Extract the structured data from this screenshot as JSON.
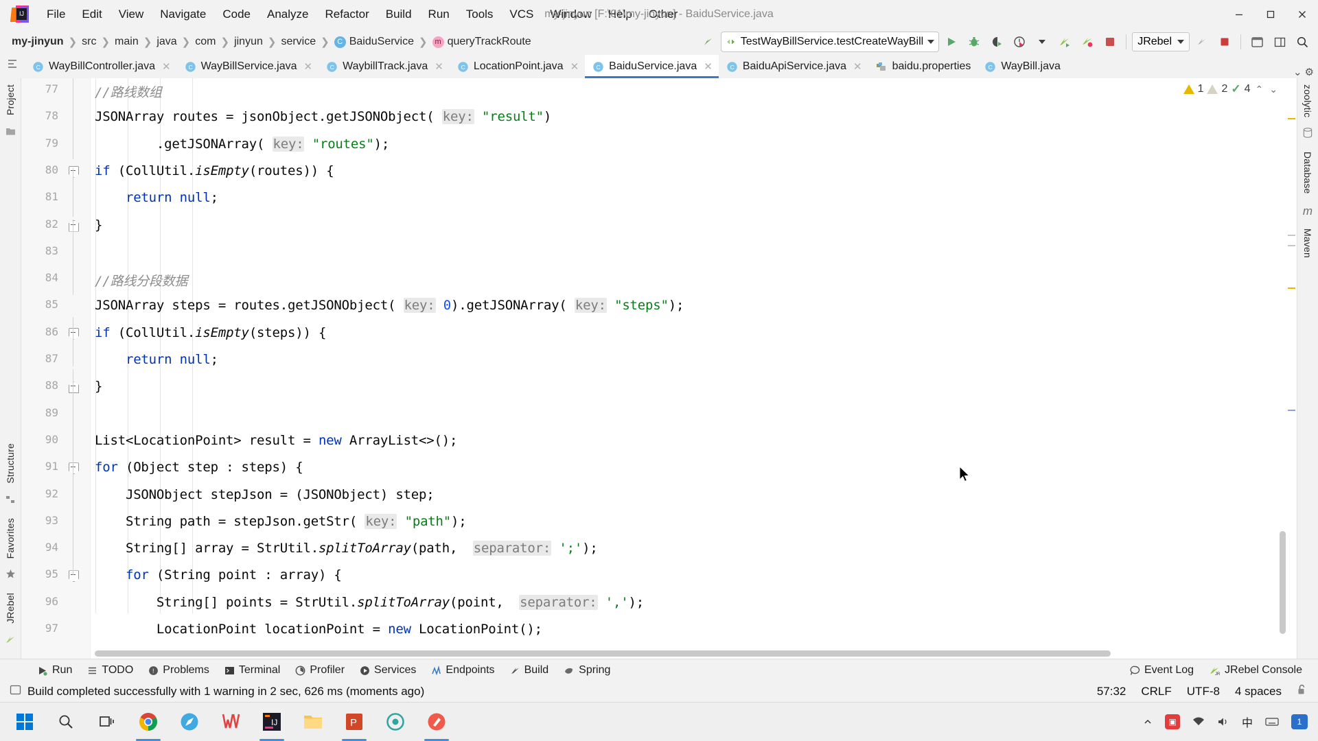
{
  "window": {
    "title": "my-jinyun [F:\\01\\my-jinyun] - BaiduService.java",
    "minimize": "—",
    "maximize": "▢",
    "close": "✕",
    "logo_text": "IJ"
  },
  "menubar": [
    {
      "label": "File",
      "mn": "F"
    },
    {
      "label": "Edit",
      "mn": "E"
    },
    {
      "label": "View",
      "mn": "V"
    },
    {
      "label": "Navigate",
      "mn": "N"
    },
    {
      "label": "Code",
      "mn": "C"
    },
    {
      "label": "Analyze",
      "mn": "z"
    },
    {
      "label": "Refactor",
      "mn": "R"
    },
    {
      "label": "Build",
      "mn": "B"
    },
    {
      "label": "Run",
      "mn": "u"
    },
    {
      "label": "Tools",
      "mn": "T"
    },
    {
      "label": "VCS",
      "mn": ""
    },
    {
      "label": "Window",
      "mn": "W"
    },
    {
      "label": "Help",
      "mn": "H"
    },
    {
      "label": "Other",
      "mn": ""
    }
  ],
  "breadcrumbs": [
    {
      "label": "my-jinyun",
      "icon": "",
      "bold": true
    },
    {
      "label": "src",
      "icon": ""
    },
    {
      "label": "main",
      "icon": ""
    },
    {
      "label": "java",
      "icon": ""
    },
    {
      "label": "com",
      "icon": ""
    },
    {
      "label": "jinyun",
      "icon": ""
    },
    {
      "label": "service",
      "icon": ""
    },
    {
      "label": "BaiduService",
      "icon": "class-icon",
      "icon_letter": "C"
    },
    {
      "label": "queryTrackRoute",
      "icon": "method-icon",
      "icon_letter": "m"
    }
  ],
  "toolbar": {
    "run_config": "TestWayBillService.testCreateWayBill",
    "jrebel_label": "JRebel",
    "icons": [
      "run-icon",
      "debug-icon",
      "run-with-coverage-icon",
      "profiler-icon",
      "profiler-dropdown-icon",
      "jrebel-run-icon",
      "jrebel-debug-icon",
      "stop-icon",
      "search-everywhere-icon"
    ]
  },
  "tabs": [
    {
      "label": "WayBillController.java",
      "icon": "java-class-icon",
      "active": false,
      "close": "✕"
    },
    {
      "label": "WayBillService.java",
      "icon": "java-class-icon",
      "active": false,
      "close": "✕"
    },
    {
      "label": "WaybillTrack.java",
      "icon": "java-class-icon",
      "active": false,
      "close": "✕"
    },
    {
      "label": "LocationPoint.java",
      "icon": "java-class-icon",
      "active": false,
      "close": "✕"
    },
    {
      "label": "BaiduService.java",
      "icon": "java-class-icon",
      "active": true,
      "close": "✕"
    },
    {
      "label": "BaiduApiService.java",
      "icon": "java-class-icon",
      "active": false,
      "close": "✕"
    },
    {
      "label": "baidu.properties",
      "icon": "properties-icon",
      "active": false,
      "close": ""
    },
    {
      "label": "WayBill.java",
      "icon": "java-class-icon",
      "active": false,
      "close": ""
    }
  ],
  "left_tool_windows": [
    {
      "label": "Project",
      "name": "tool-window-project"
    },
    {
      "label": "Structure",
      "name": "tool-window-structure"
    },
    {
      "label": "Favorites",
      "name": "tool-window-favorites"
    },
    {
      "label": "JRebel",
      "name": "tool-window-jrebel"
    }
  ],
  "right_tool_windows": [
    {
      "label": "zoolytic",
      "name": "tool-window-zoolytic"
    },
    {
      "label": "Database",
      "name": "tool-window-database"
    },
    {
      "label": "Maven",
      "name": "tool-window-maven"
    }
  ],
  "inspections": {
    "warnings": "1",
    "weak_warnings": "2",
    "ok_count": "4",
    "up": "⌃",
    "down": "⌄"
  },
  "editor": {
    "first_line": 77,
    "lines": [
      {
        "n": 77,
        "indent": 2,
        "tokens": [
          {
            "t": "//路线数组",
            "c": "cmt"
          }
        ]
      },
      {
        "n": 78,
        "indent": 2,
        "tokens": [
          {
            "t": "JSONArray routes = jsonObject.getJSONObject( ",
            "c": ""
          },
          {
            "t": "key:",
            "c": "hint"
          },
          {
            "t": " ",
            "c": ""
          },
          {
            "t": "\"result\"",
            "c": "str"
          },
          {
            "t": ")",
            "c": ""
          }
        ]
      },
      {
        "n": 79,
        "indent": 2,
        "tokens": [
          {
            "t": "        .getJSONArray( ",
            "c": ""
          },
          {
            "t": "key:",
            "c": "hint"
          },
          {
            "t": " ",
            "c": ""
          },
          {
            "t": "\"routes\"",
            "c": "str"
          },
          {
            "t": ");",
            "c": ""
          }
        ]
      },
      {
        "n": 80,
        "indent": 2,
        "fold": "start",
        "tokens": [
          {
            "t": "if",
            "c": "kw"
          },
          {
            "t": " (CollUtil.",
            "c": ""
          },
          {
            "t": "isEmpty",
            "c": "italmeth"
          },
          {
            "t": "(routes)) {",
            "c": ""
          }
        ]
      },
      {
        "n": 81,
        "indent": 3,
        "tokens": [
          {
            "t": "    ",
            "c": ""
          },
          {
            "t": "return",
            "c": "kw"
          },
          {
            "t": " ",
            "c": ""
          },
          {
            "t": "null",
            "c": "kw"
          },
          {
            "t": ";",
            "c": ""
          }
        ]
      },
      {
        "n": 82,
        "indent": 2,
        "fold": "end",
        "tokens": [
          {
            "t": "}",
            "c": ""
          }
        ]
      },
      {
        "n": 83,
        "indent": 2,
        "tokens": []
      },
      {
        "n": 84,
        "indent": 2,
        "tokens": [
          {
            "t": "//路线分段数据",
            "c": "cmt"
          }
        ]
      },
      {
        "n": 85,
        "indent": 2,
        "tokens": [
          {
            "t": "JSONArray steps = routes.getJSONObject( ",
            "c": ""
          },
          {
            "t": "key:",
            "c": "hint"
          },
          {
            "t": " ",
            "c": ""
          },
          {
            "t": "0",
            "c": "num"
          },
          {
            "t": ").getJSONArray( ",
            "c": ""
          },
          {
            "t": "key:",
            "c": "hint"
          },
          {
            "t": " ",
            "c": ""
          },
          {
            "t": "\"steps\"",
            "c": "str"
          },
          {
            "t": ");",
            "c": ""
          }
        ]
      },
      {
        "n": 86,
        "indent": 2,
        "fold": "start",
        "tokens": [
          {
            "t": "if",
            "c": "kw"
          },
          {
            "t": " (CollUtil.",
            "c": ""
          },
          {
            "t": "isEmpty",
            "c": "italmeth"
          },
          {
            "t": "(steps)) {",
            "c": ""
          }
        ]
      },
      {
        "n": 87,
        "indent": 3,
        "tokens": [
          {
            "t": "    ",
            "c": ""
          },
          {
            "t": "return",
            "c": "kw"
          },
          {
            "t": " ",
            "c": ""
          },
          {
            "t": "null",
            "c": "kw"
          },
          {
            "t": ";",
            "c": ""
          }
        ]
      },
      {
        "n": 88,
        "indent": 2,
        "fold": "end",
        "tokens": [
          {
            "t": "}",
            "c": ""
          }
        ]
      },
      {
        "n": 89,
        "indent": 2,
        "tokens": []
      },
      {
        "n": 90,
        "indent": 2,
        "tokens": [
          {
            "t": "List<LocationPoint> result = ",
            "c": ""
          },
          {
            "t": "new",
            "c": "kw"
          },
          {
            "t": " ArrayList<>();",
            "c": ""
          }
        ]
      },
      {
        "n": 91,
        "indent": 2,
        "fold": "start",
        "tokens": [
          {
            "t": "for",
            "c": "kw"
          },
          {
            "t": " (Object step : steps) {",
            "c": ""
          }
        ]
      },
      {
        "n": 92,
        "indent": 3,
        "tokens": [
          {
            "t": "    JSONObject stepJson = (JSONObject) step;",
            "c": ""
          }
        ]
      },
      {
        "n": 93,
        "indent": 3,
        "tokens": [
          {
            "t": "    String path = stepJson.getStr( ",
            "c": ""
          },
          {
            "t": "key:",
            "c": "hint"
          },
          {
            "t": " ",
            "c": ""
          },
          {
            "t": "\"path\"",
            "c": "str"
          },
          {
            "t": ");",
            "c": ""
          }
        ]
      },
      {
        "n": 94,
        "indent": 3,
        "tokens": [
          {
            "t": "    String[] array = StrUtil.",
            "c": ""
          },
          {
            "t": "splitToArray",
            "c": "italmeth"
          },
          {
            "t": "(path,  ",
            "c": ""
          },
          {
            "t": "separator:",
            "c": "hint"
          },
          {
            "t": " ",
            "c": ""
          },
          {
            "t": "';'",
            "c": "str"
          },
          {
            "t": ");",
            "c": ""
          }
        ]
      },
      {
        "n": 95,
        "indent": 3,
        "fold": "start",
        "tokens": [
          {
            "t": "    ",
            "c": ""
          },
          {
            "t": "for",
            "c": "kw"
          },
          {
            "t": " (String point : array) {",
            "c": ""
          }
        ]
      },
      {
        "n": 96,
        "indent": 4,
        "tokens": [
          {
            "t": "        String[] points = StrUtil.",
            "c": ""
          },
          {
            "t": "splitToArray",
            "c": "italmeth"
          },
          {
            "t": "(point,  ",
            "c": ""
          },
          {
            "t": "separator:",
            "c": "hint"
          },
          {
            "t": " ",
            "c": ""
          },
          {
            "t": "','",
            "c": "str"
          },
          {
            "t": ");",
            "c": ""
          }
        ]
      },
      {
        "n": 97,
        "indent": 4,
        "tokens": [
          {
            "t": "        LocationPoint locationPoint = ",
            "c": ""
          },
          {
            "t": "new",
            "c": "kw"
          },
          {
            "t": " LocationPoint();",
            "c": ""
          }
        ]
      }
    ]
  },
  "bottom_tool_windows": [
    {
      "label": "Run",
      "icon": "run-icon"
    },
    {
      "label": "TODO",
      "icon": "todo-icon"
    },
    {
      "label": "Problems",
      "icon": "problems-icon"
    },
    {
      "label": "Terminal",
      "icon": "terminal-icon"
    },
    {
      "label": "Profiler",
      "icon": "profiler-icon"
    },
    {
      "label": "Services",
      "icon": "services-icon"
    },
    {
      "label": "Endpoints",
      "icon": "endpoints-icon"
    },
    {
      "label": "Build",
      "icon": "build-icon"
    },
    {
      "label": "Spring",
      "icon": "spring-icon"
    }
  ],
  "bottom_right": [
    {
      "label": "Event Log",
      "icon": "event-log-icon"
    },
    {
      "label": "JRebel Console",
      "icon": "jrebel-icon"
    }
  ],
  "statusbar": {
    "message": "Build completed successfully with 1 warning in 2 sec, 626 ms (moments ago)",
    "caret": "57:32",
    "line_sep": "CRLF",
    "encoding": "UTF-8",
    "indent": "4 spaces",
    "lock": "lock-open-icon"
  },
  "taskbar": {
    "items": [
      {
        "name": "start-button",
        "icon": "windows-logo"
      },
      {
        "name": "search-button",
        "icon": "search-icon"
      },
      {
        "name": "task-view-button",
        "icon": "task-view-icon"
      },
      {
        "name": "chrome-app",
        "icon": "chrome-icon",
        "running": true
      },
      {
        "name": "browser-app",
        "icon": "compass-icon",
        "running": false
      },
      {
        "name": "editor-app",
        "icon": "wps-icon",
        "running": false
      },
      {
        "name": "intellij-app",
        "icon": "intellij-icon",
        "running": true
      },
      {
        "name": "explorer-app",
        "icon": "folder-icon",
        "running": false
      },
      {
        "name": "powerpoint-app",
        "icon": "powerpoint-icon",
        "running": true
      },
      {
        "name": "player-app",
        "icon": "circle-icon",
        "running": false
      },
      {
        "name": "snipaste-app",
        "icon": "pen-icon",
        "running": true
      }
    ],
    "tray": [
      {
        "name": "tray-expand",
        "glyph": "⌃"
      },
      {
        "name": "tray-security",
        "glyph": "▤"
      },
      {
        "name": "tray-network",
        "glyph": "⌂"
      },
      {
        "name": "tray-volume",
        "glyph": "🔊"
      },
      {
        "name": "tray-ime",
        "glyph": "中"
      },
      {
        "name": "tray-keyboard",
        "glyph": "⌨"
      },
      {
        "name": "tray-notifications",
        "glyph": "1"
      }
    ]
  },
  "colors": {
    "accent": "#3a79c8",
    "keyword": "#0033b3",
    "string": "#067d17",
    "number": "#1750eb",
    "comment": "#8c8c8c",
    "hint_bg": "#e9e9e9",
    "chrome_bg": "#f2f2f2",
    "editor_bg": "#ffffff",
    "warning": "#e6b800",
    "ok": "#59a869"
  }
}
